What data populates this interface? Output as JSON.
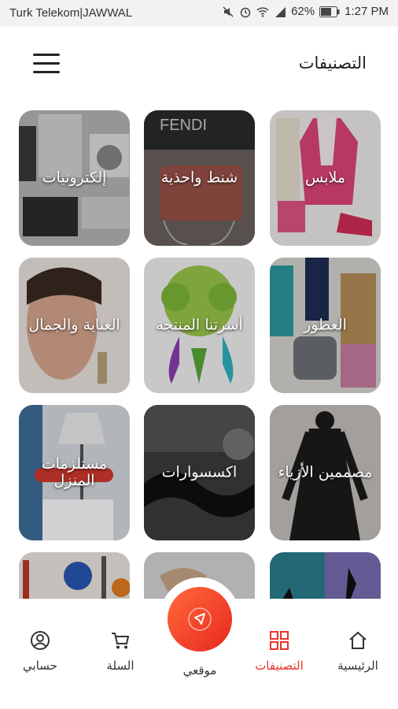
{
  "status_bar": {
    "carrier": "Turk Telekom|JAWWAL",
    "battery": "62%",
    "time": "1:27 PM",
    "icons": [
      "mute-icon",
      "alarm-icon",
      "wifi-icon",
      "signal-icon",
      "battery-icon"
    ]
  },
  "header": {
    "title": "التصنيفات",
    "menu_icon": "hamburger-icon"
  },
  "categories": [
    {
      "label": "ملابس",
      "icon": "clothing-image"
    },
    {
      "label": "شنط واحذية",
      "icon": "bags-shoes-image"
    },
    {
      "label": "إلكترونيات",
      "icon": "electronics-image"
    },
    {
      "label": "العطور",
      "icon": "perfume-image"
    },
    {
      "label": "أسرتنا المنتجة",
      "icon": "productive-families-image"
    },
    {
      "label": "العناية والجمال",
      "icon": "beauty-care-image"
    },
    {
      "label": "مصممين الأزياء",
      "icon": "fashion-designers-image"
    },
    {
      "label": "اكسسوارات",
      "icon": "accessories-image"
    },
    {
      "label": "مستلزمات المنزل",
      "icon": "home-supplies-image"
    },
    {
      "label": "",
      "icon": "dance-image"
    },
    {
      "label": "",
      "icon": "misc-image"
    },
    {
      "label": "",
      "icon": "sports-image"
    }
  ],
  "tabbar": {
    "home": "الرئيسية",
    "categories": "التصنيفات",
    "location": "موقعي",
    "cart": "السلة",
    "account": "حسابي",
    "active": "categories",
    "accent_color": "#e8342a"
  }
}
